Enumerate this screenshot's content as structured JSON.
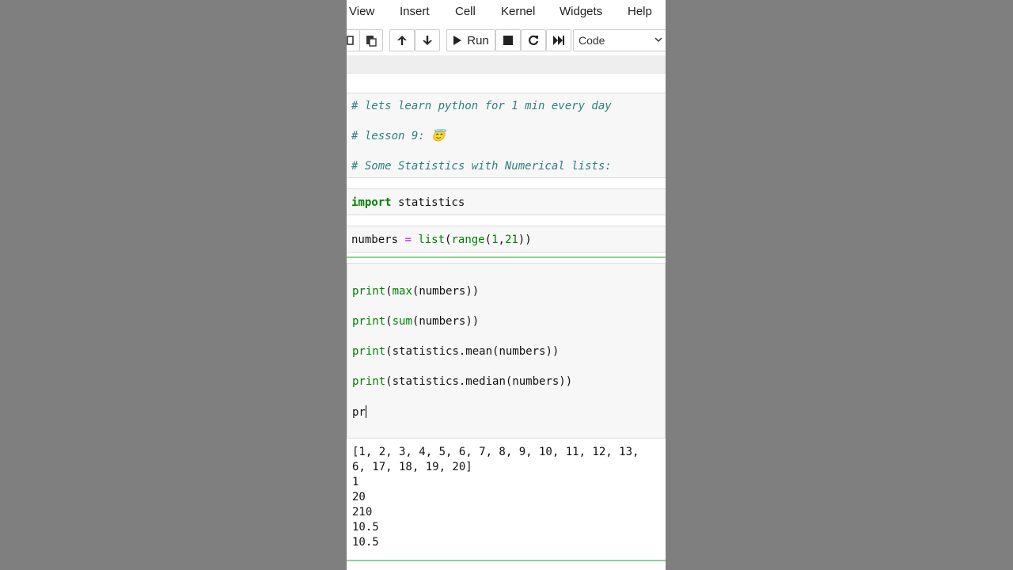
{
  "menubar": {
    "items": [
      "View",
      "Insert",
      "Cell",
      "Kernel",
      "Widgets",
      "Help"
    ]
  },
  "toolbar": {
    "run_label": "Run",
    "cell_type": "Code",
    "icons": [
      "copy-icon",
      "paste-icon",
      "move-up-icon",
      "move-down-icon",
      "run-icon",
      "stop-icon",
      "restart-icon",
      "fast-forward-icon",
      "chevron-down-icon"
    ]
  },
  "cells": {
    "markdown": {
      "line1": "# lets learn python for 1 min every day",
      "line2": "# lesson 9: 😇",
      "line3": "# Some Statistics with Numerical lists:"
    },
    "import_cell": {
      "keyword": "import",
      "rest": " statistics"
    },
    "numbers_cell": {
      "var": "numbers ",
      "op": "=",
      "space": " ",
      "fn1": "list",
      "p1": "(",
      "fn2": "range",
      "p2": "(",
      "n1": "1",
      "comma": ",",
      "n2": "21",
      "close": "))"
    },
    "edit_cell": {
      "l1_fn": "print",
      "l1_a": "(",
      "l1_b": "max",
      "l1_c": "(numbers))",
      "l2_fn": "print",
      "l2_a": "(",
      "l2_b": "sum",
      "l2_c": "(numbers))",
      "l3_fn": "print",
      "l3_rest": "(statistics.mean(numbers))",
      "l4_fn": "print",
      "l4_rest": "(statistics.median(numbers))",
      "l5": "pr"
    }
  },
  "output": {
    "lines": [
      "[1, 2, 3, 4, 5, 6, 7, 8, 9, 10, 11, 12, 13,",
      "6, 17, 18, 19, 20]",
      "1",
      "20",
      "210",
      "10.5",
      "10.5"
    ]
  },
  "colors": {
    "comment": "#2f8080",
    "keyword": "#008000",
    "operator": "#aa22ff",
    "selected_cell_border": "#8fd18f"
  }
}
